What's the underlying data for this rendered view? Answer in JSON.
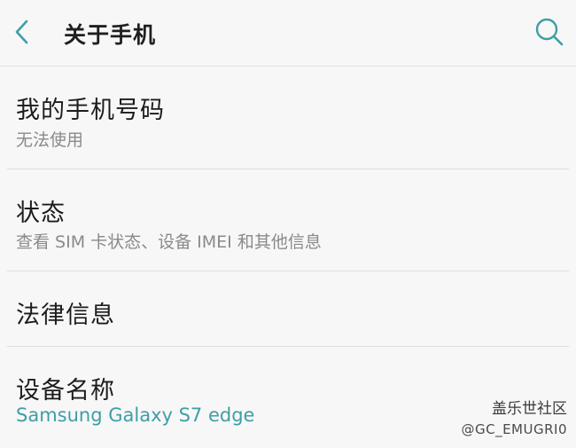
{
  "header": {
    "title": "关于手机",
    "back_icon": "chevron-left-icon",
    "search_icon": "search-icon"
  },
  "items": [
    {
      "title": "我的手机号码",
      "subtitle": "无法使用"
    },
    {
      "title": "状态",
      "subtitle": "查看 SIM 卡状态、设备 IMEI 和其他信息"
    },
    {
      "title": "法律信息"
    },
    {
      "title": "设备名称",
      "subtitle": "Samsung Galaxy S7 edge"
    }
  ],
  "watermark": {
    "line1": "盖乐世社区",
    "line2": "@GC_EMUGRI0"
  },
  "colors": {
    "accent": "#3e9ea6",
    "background": "#f7f7f7",
    "title_text": "#1c1c1c",
    "subtitle_text": "#8a8a8a"
  }
}
